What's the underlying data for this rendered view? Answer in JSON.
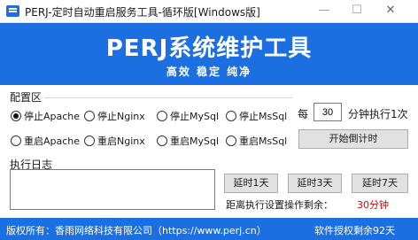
{
  "window": {
    "title": "PERJ-定时自动重启服务工具-循环版[Windows版]",
    "minimize": "—",
    "maximize": "☐",
    "close": "✕"
  },
  "banner": {
    "title": "PERJ系统维护工具",
    "subtitle": "高效  稳定  纯净"
  },
  "config": {
    "label": "配置区",
    "radios": [
      {
        "label": "停止Apache",
        "checked": true
      },
      {
        "label": "停止Nginx",
        "checked": false
      },
      {
        "label": "停止MySql",
        "checked": false
      },
      {
        "label": "停止MsSql",
        "checked": false
      },
      {
        "label": "重启Apache",
        "checked": false
      },
      {
        "label": "重启Nginx",
        "checked": false
      },
      {
        "label": "重启MySql",
        "checked": false
      },
      {
        "label": "重启MsSql",
        "checked": false
      }
    ],
    "every_prefix": "每",
    "interval_value": "30",
    "every_suffix": "分钟执行1次",
    "start_button": "开始倒计时"
  },
  "log": {
    "label": "执行日志",
    "content": ""
  },
  "delay": {
    "btn1": "延时1天",
    "btn3": "延时3天",
    "btn7": "延时7天",
    "remaining_label": "距离执行设置操作剩余：",
    "remaining_value": "30分钟",
    "remaining_color": "#e00000"
  },
  "footer": {
    "copyright": "版权所有：香雨网络科技有限公司（https://www.perj.cn）",
    "license": "软件授权剩余92天"
  },
  "colors": {
    "brand": "#1c6fe0"
  }
}
